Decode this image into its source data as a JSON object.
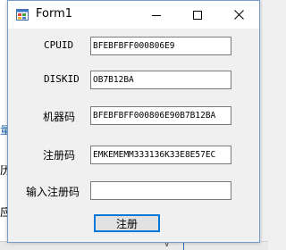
{
  "window": {
    "title": "Form1"
  },
  "form": {
    "rows": [
      {
        "label": "CPUID",
        "value": "BFEBFBFF000806E9"
      },
      {
        "label": "DISKID",
        "value": "OB7B12BA"
      },
      {
        "label": "机器码",
        "value": "BFEBFBFF000806E90B7B12BA"
      },
      {
        "label": "注册码",
        "value": "EMKEMEMM333136K33E8E57EC"
      },
      {
        "label": "输入注册码",
        "value": ""
      }
    ],
    "register_button": "注册"
  },
  "background": {
    "glyphs": [
      "量",
      "历",
      "应"
    ]
  },
  "colors": {
    "accent": "#0078d7",
    "window_border": "#7a9cc8",
    "form_bg": "#f0f0f0"
  },
  "icons": {
    "app": "winforms-app-icon",
    "minimize": "minimize-icon",
    "maximize": "maximize-icon",
    "close": "close-icon"
  }
}
